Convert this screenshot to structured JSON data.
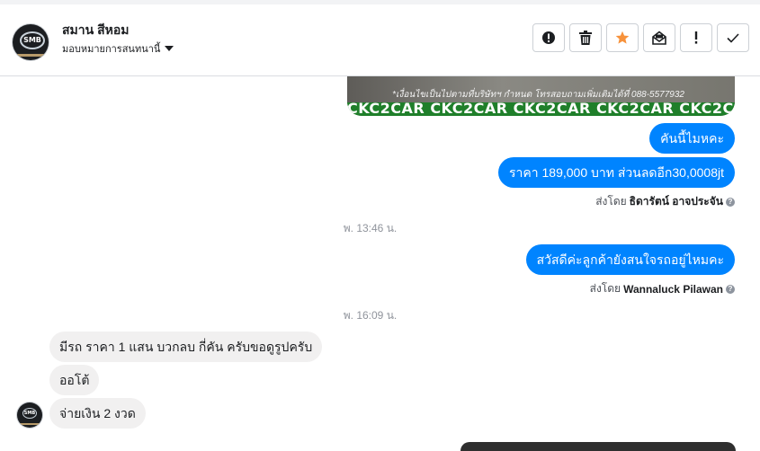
{
  "colors": {
    "accent": "#0084ff",
    "incoming": "#f1f0f0",
    "star": "#f7923b"
  },
  "header": {
    "page_name": "สมาน สีหอม",
    "assign_label": "มอบหมายการสนทนานี้",
    "avatar_text": "SMB",
    "actions": [
      {
        "name": "spam-button",
        "icon": "alert-circle-icon"
      },
      {
        "name": "delete-button",
        "icon": "trash-icon"
      },
      {
        "name": "star-button",
        "icon": "star-icon"
      },
      {
        "name": "unread-button",
        "icon": "envelope-icon"
      },
      {
        "name": "important-button",
        "icon": "exclamation-icon"
      },
      {
        "name": "done-button",
        "icon": "check-icon"
      }
    ]
  },
  "thread": {
    "image_note": "*เงื่อนไขเป็นไปตามที่บริษัทฯ กำหนด โทรสอบถามเพิ่มเติมได้ที่ 088-5577932",
    "image_strip": "CKC2CAR CKC2CAR CKC2CAR CKC2CAR CKC2CAR CKC2",
    "out_messages_1": [
      "คันนี้ไมหคะ",
      "ราคา 189,000 บาท ส่วนลดอีก30,0008jt"
    ],
    "sent_by_prefix": "ส่งโดย",
    "sender_1": "ธิดารัตน์ อาจประจัน",
    "time_1": "พ. 13:46 น.",
    "out_message_2": "สวัสดีค่ะลูกค้ายังสนใจรถอยู่ไหมคะ",
    "sender_2": "Wannaluck Pilawan",
    "time_2": "พ. 16:09 น.",
    "in_messages": [
      "มีรถ ราคา 1 แสน บวกลบ กี่คัน ครับขอดูรูปครับ",
      "ออโต้",
      "จ่ายเงิน 2 งวด"
    ]
  }
}
